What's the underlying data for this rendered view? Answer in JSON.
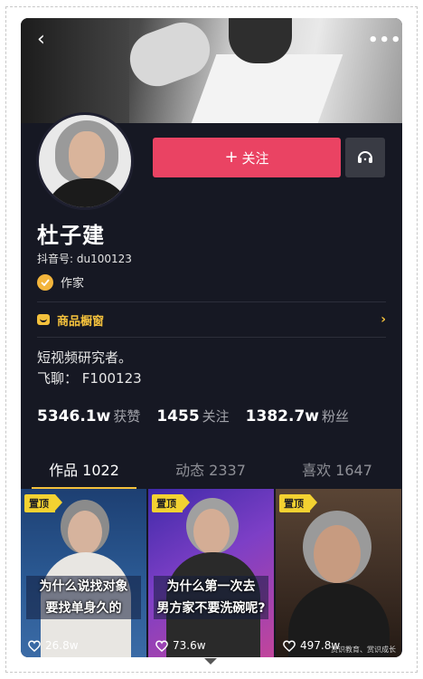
{
  "header": {
    "back_icon": "‹",
    "more_icon": "•••"
  },
  "profile": {
    "follow_label": "关注",
    "follow_plus": "+",
    "name": "杜子建",
    "douyin_id": "抖音号: du100123",
    "verified_title": "作家",
    "shop_label": "商品橱窗",
    "shop_chevron": "›",
    "bio_line1": "短视频研究者。",
    "bio_line2": "飞聊： F100123",
    "colors": {
      "accent_red": "#ea4363",
      "gold": "#f4c13c",
      "background": "#161823"
    }
  },
  "stats": [
    {
      "num": "5346.1w",
      "label": "获赞"
    },
    {
      "num": "1455",
      "label": "关注"
    },
    {
      "num": "1382.7w",
      "label": "粉丝"
    }
  ],
  "tabs": [
    {
      "label": "作品 1022"
    },
    {
      "label": "动态 2337"
    },
    {
      "label": "喜欢 1647"
    }
  ],
  "videos": [
    {
      "pin": "置顶",
      "caption1": "为什么说找对象",
      "caption2": "要找单身久的",
      "likes": "26.8w",
      "watermark": ""
    },
    {
      "pin": "置顶",
      "caption1": "为什么第一次去",
      "caption2": "男方家不要洗碗呢?",
      "likes": "73.6w",
      "watermark": ""
    },
    {
      "pin": "置顶",
      "caption1": "",
      "caption2": "",
      "likes": "497.8w",
      "watermark": "赏识教育、赏识成长"
    }
  ]
}
